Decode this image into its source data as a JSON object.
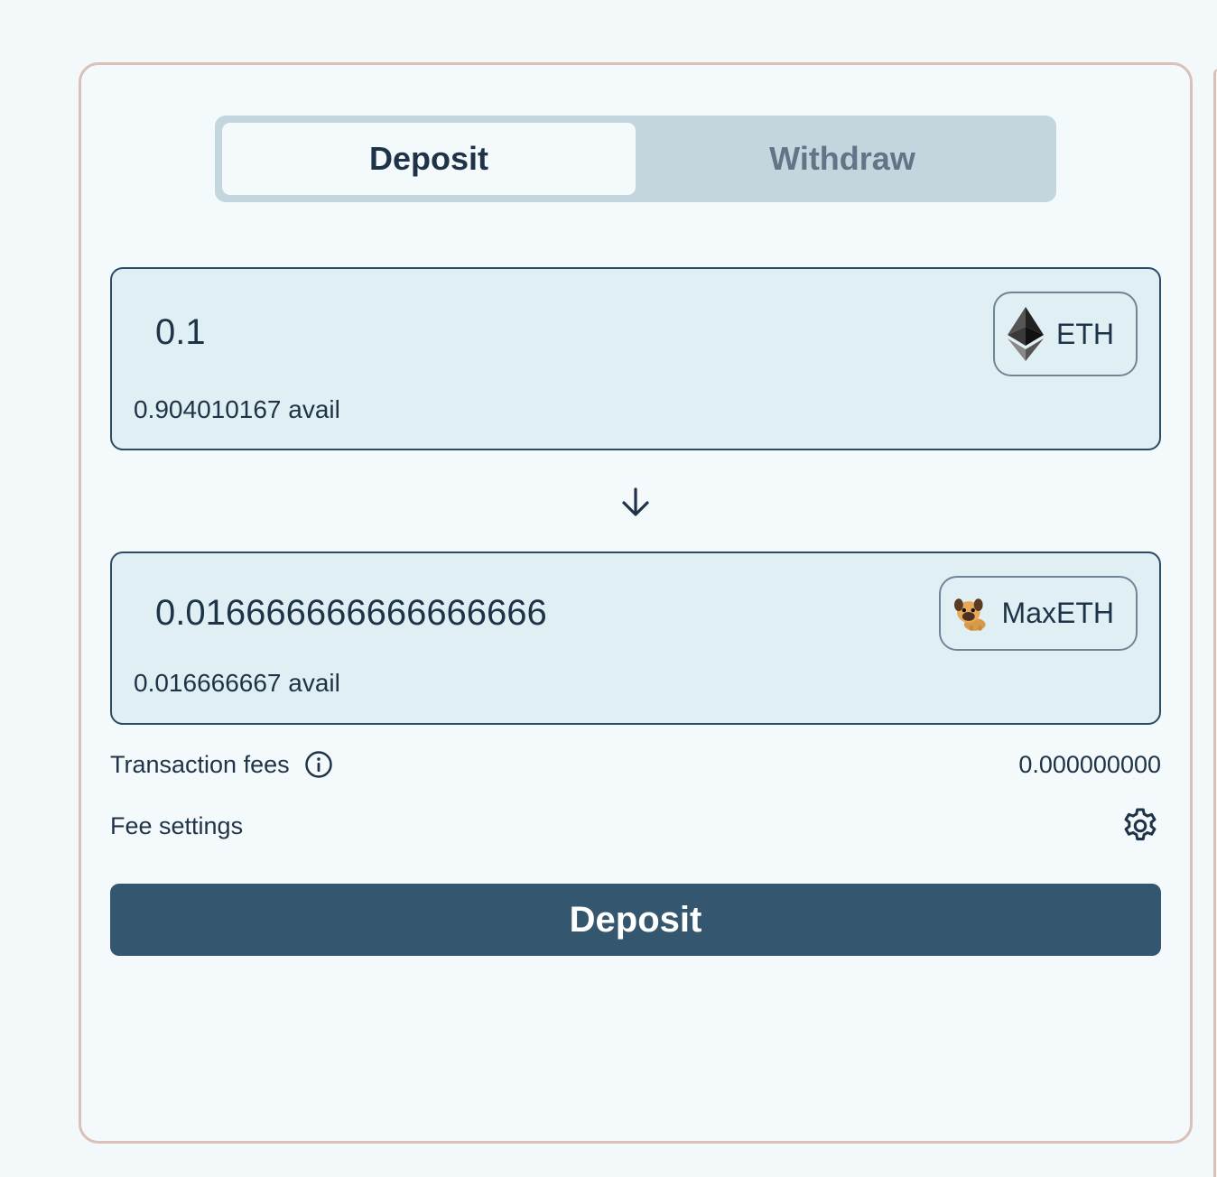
{
  "tabs": [
    {
      "label": "Deposit",
      "active": true
    },
    {
      "label": "Withdraw",
      "active": false
    }
  ],
  "source": {
    "amount": "0.1",
    "available": "0.904010167 avail",
    "token": "ETH",
    "token_icon": "ethereum-icon"
  },
  "destination": {
    "amount": "0.016666666666666666",
    "available": "0.016666667 avail",
    "token": "MaxETH",
    "token_icon": "pug-icon"
  },
  "fees": {
    "label": "Transaction fees",
    "value": "0.000000000"
  },
  "fee_settings": {
    "label": "Fee settings"
  },
  "action": {
    "label": "Deposit"
  },
  "colors": {
    "primary": "#34566e",
    "panel_border": "#d8c1b8",
    "input_bg": "#dfeff4",
    "tab_track": "#c4d6dd"
  }
}
